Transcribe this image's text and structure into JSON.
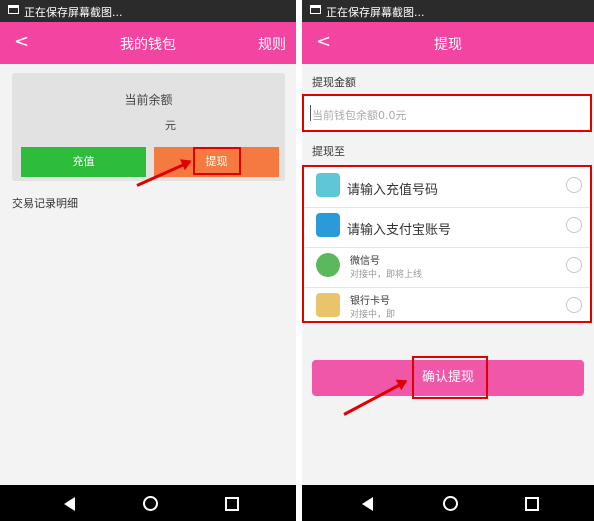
{
  "status_bar": {
    "text": "正在保存屏幕截图..."
  },
  "wallet": {
    "title": "我的钱包",
    "rules_label": "规则",
    "balance_label": "当前余额",
    "balance_unit": "元",
    "recharge_label": "充值",
    "withdraw_label": "提现",
    "records_label": "交易记录明细"
  },
  "withdraw": {
    "title": "提现",
    "amount_label": "提现金额",
    "amount_placeholder": "当前钱包余额0.0元",
    "to_label": "提现至",
    "options": [
      {
        "label": "请输入充值号码",
        "icon": "recharge-icon"
      },
      {
        "label": "请输入支付宝账号",
        "icon": "alipay-icon"
      },
      {
        "label": "微信号",
        "sub": "对接中，即将上线",
        "icon": "wechat-icon"
      },
      {
        "label": "银行卡号",
        "sub": "对接中，即",
        "icon": "bank-card-icon"
      }
    ],
    "confirm_label": "确认提现"
  },
  "colors": {
    "brand_pink": "#f244a0",
    "recharge_green": "#2ebd3b",
    "withdraw_orange": "#f47a3f",
    "highlight_red": "#e00000"
  }
}
